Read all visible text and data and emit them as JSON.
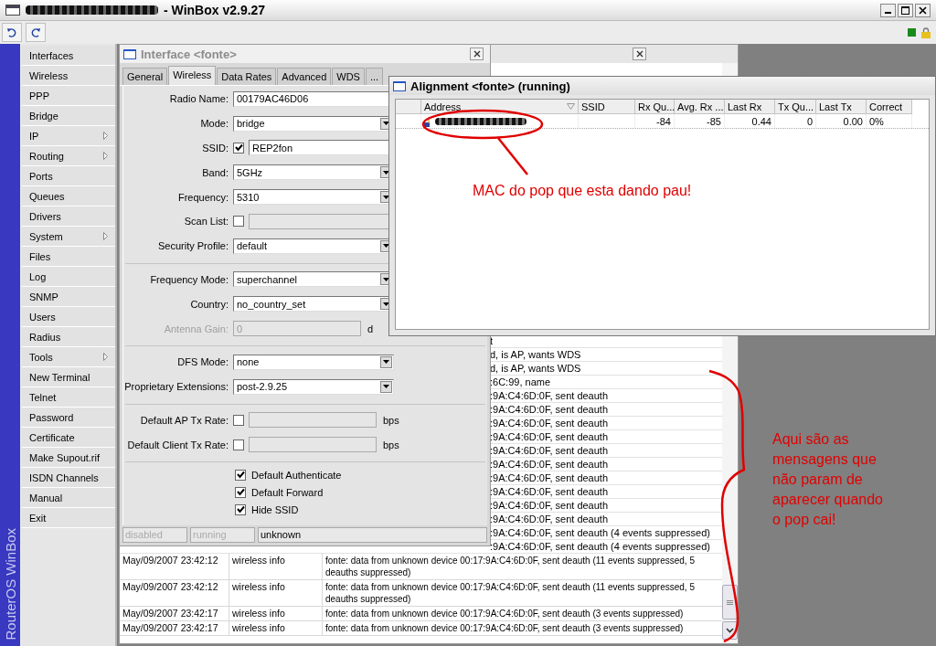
{
  "window": {
    "title": "- WinBox v2.9.27"
  },
  "sidebar": {
    "brand": "RouterOS WinBox",
    "items": [
      {
        "label": "Interfaces",
        "submenu": false
      },
      {
        "label": "Wireless",
        "submenu": false
      },
      {
        "label": "PPP",
        "submenu": false
      },
      {
        "label": "Bridge",
        "submenu": false
      },
      {
        "label": "IP",
        "submenu": true
      },
      {
        "label": "Routing",
        "submenu": true
      },
      {
        "label": "Ports",
        "submenu": false
      },
      {
        "label": "Queues",
        "submenu": false
      },
      {
        "label": "Drivers",
        "submenu": false
      },
      {
        "label": "System",
        "submenu": true
      },
      {
        "label": "Files",
        "submenu": false
      },
      {
        "label": "Log",
        "submenu": false
      },
      {
        "label": "SNMP",
        "submenu": false
      },
      {
        "label": "Users",
        "submenu": false
      },
      {
        "label": "Radius",
        "submenu": false
      },
      {
        "label": "Tools",
        "submenu": true
      },
      {
        "label": "New Terminal",
        "submenu": false
      },
      {
        "label": "Telnet",
        "submenu": false
      },
      {
        "label": "Password",
        "submenu": false
      },
      {
        "label": "Certificate",
        "submenu": false
      },
      {
        "label": "Make Supout.rif",
        "submenu": false
      },
      {
        "label": "ISDN Channels",
        "submenu": false
      },
      {
        "label": "Manual",
        "submenu": false
      },
      {
        "label": "Exit",
        "submenu": false
      }
    ]
  },
  "log_window": {
    "partial_rows": [
      "t",
      "d, is AP, wants WDS",
      "d, is AP, wants WDS",
      ":6C:99, name",
      ":9A:C4:6D:0F, sent deauth",
      ":9A:C4:6D:0F, sent deauth",
      ":9A:C4:6D:0F, sent deauth",
      ":9A:C4:6D:0F, sent deauth",
      ":9A:C4:6D:0F, sent deauth",
      ":9A:C4:6D:0F, sent deauth",
      ":9A:C4:6D:0F, sent deauth",
      ":9A:C4:6D:0F, sent deauth",
      ":9A:C4:6D:0F, sent deauth",
      ":9A:C4:6D:0F, sent deauth",
      ":9A:C4:6D:0F, sent deauth (4 events suppressed)",
      ":9A:C4:6D:0F, sent deauth (4 events suppressed)"
    ],
    "rows": [
      {
        "time": "May/09/2007 23:42:12",
        "topic": "wireless info",
        "message": "fonte: data from unknown device 00:17:9A:C4:6D:0F, sent deauth (11 events suppressed, 5 deauths suppressed)"
      },
      {
        "time": "May/09/2007 23:42:12",
        "topic": "wireless info",
        "message": "fonte: data from unknown device 00:17:9A:C4:6D:0F, sent deauth (11 events suppressed, 5 deauths suppressed)"
      },
      {
        "time": "May/09/2007 23:42:17",
        "topic": "wireless info",
        "message": "fonte: data from unknown device 00:17:9A:C4:6D:0F, sent deauth (3 events suppressed)"
      },
      {
        "time": "May/09/2007 23:42:17",
        "topic": "wireless info",
        "message": "fonte: data from unknown device 00:17:9A:C4:6D:0F, sent deauth (3 events suppressed)"
      }
    ]
  },
  "interface_window": {
    "title": "Interface <fonte>",
    "active": false,
    "tabs": [
      {
        "label": "General",
        "selected": false
      },
      {
        "label": "Wireless",
        "selected": true
      },
      {
        "label": "Data Rates",
        "selected": false
      },
      {
        "label": "Advanced",
        "selected": false
      },
      {
        "label": "WDS",
        "selected": false
      },
      {
        "label": "...",
        "selected": false
      }
    ],
    "fields": [
      {
        "kind": "text",
        "label": "Radio Name:",
        "value": "00179AC46D06"
      },
      {
        "kind": "select",
        "label": "Mode:",
        "value": "bridge"
      },
      {
        "kind": "check_text",
        "label": "SSID:",
        "checked": true,
        "value": "REP2fon"
      },
      {
        "kind": "select",
        "label": "Band:",
        "value": "5GHz"
      },
      {
        "kind": "select",
        "label": "Frequency:",
        "value": "5310"
      },
      {
        "kind": "check_field",
        "label": "Scan List:",
        "checked": false
      },
      {
        "kind": "select",
        "label": "Security Profile:",
        "value": "default"
      },
      {
        "kind": "separator"
      },
      {
        "kind": "select",
        "label": "Frequency Mode:",
        "value": "superchannel"
      },
      {
        "kind": "select",
        "label": "Country:",
        "value": "no_country_set"
      },
      {
        "kind": "text",
        "label": "Antenna Gain:",
        "value": "0",
        "disabled": true,
        "unit": "d"
      },
      {
        "kind": "separator"
      },
      {
        "kind": "select",
        "label": "DFS Mode:",
        "value": "none"
      },
      {
        "kind": "select",
        "label": "Proprietary Extensions:",
        "value": "post-2.9.25"
      },
      {
        "kind": "separator"
      },
      {
        "kind": "check_field",
        "label": "Default AP Tx Rate:",
        "checked": false,
        "unit": "bps"
      },
      {
        "kind": "check_field",
        "label": "Default Client Tx Rate:",
        "checked": false,
        "unit": "bps"
      },
      {
        "kind": "separator"
      },
      {
        "kind": "checkbox",
        "label": "Default Authenticate",
        "checked": true
      },
      {
        "kind": "checkbox",
        "label": "Default Forward",
        "checked": true
      },
      {
        "kind": "checkbox",
        "label": "Hide SSID",
        "checked": true
      }
    ],
    "status": [
      {
        "text": "disabled",
        "dimmed": true
      },
      {
        "text": "running",
        "dimmed": true
      },
      {
        "text": "unknown",
        "dimmed": false
      }
    ]
  },
  "alignment_window": {
    "title": "Alignment <fonte> (running)",
    "active": true,
    "columns": [
      "Address",
      "SSID",
      "Rx Qu...",
      "Avg. Rx ...",
      "Last Rx",
      "Tx Qu...",
      "Last Tx",
      "Correct"
    ],
    "rows": [
      {
        "rx_quality": "-84",
        "avg_rx": "-85",
        "last_rx": "0.44",
        "tx_quality": "0",
        "last_tx": "0.00",
        "correct": "0%"
      }
    ]
  },
  "annotations": [
    {
      "kind": "callout",
      "text": "MAC do pop que esta dando pau!"
    },
    {
      "kind": "brace",
      "text": "Aqui são as mensagens que não param de aparecer quando o pop cai!"
    }
  ]
}
